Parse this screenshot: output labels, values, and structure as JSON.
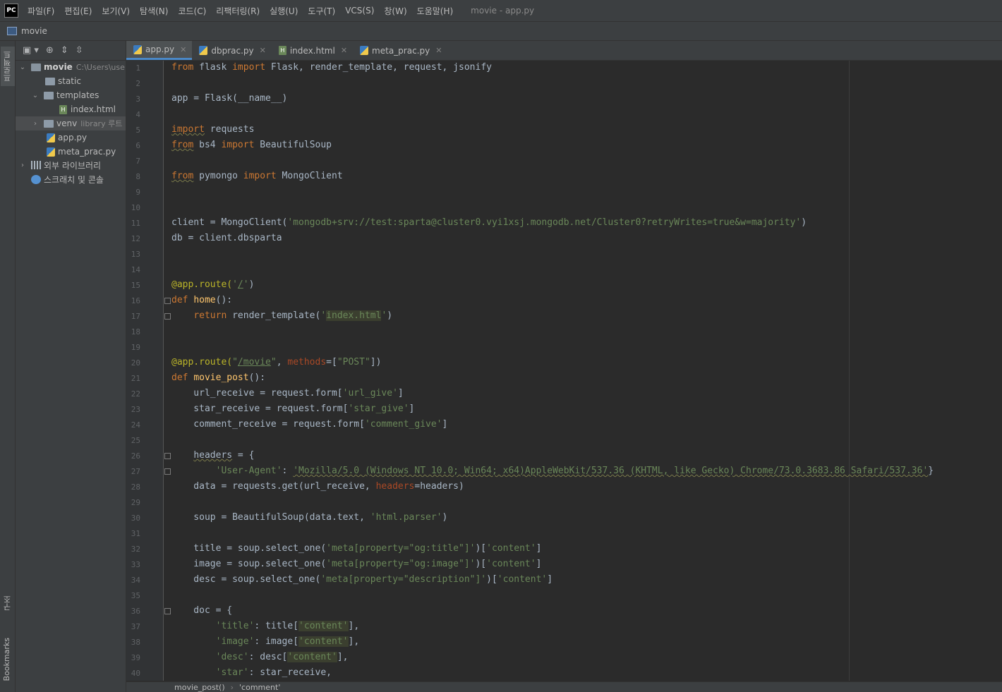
{
  "app": {
    "logo": "PC",
    "window_title": "movie - app.py"
  },
  "menu": [
    "파일(F)",
    "편집(E)",
    "보기(V)",
    "탐색(N)",
    "코드(C)",
    "리팩터링(R)",
    "실행(U)",
    "도구(T)",
    "VCS(S)",
    "창(W)",
    "도움말(H)"
  ],
  "navbar": {
    "project": "movie"
  },
  "tool_stripe": {
    "project": "프로젝트",
    "structure": "구조",
    "bookmarks": "Bookmarks"
  },
  "project_tree": {
    "root_name": "movie",
    "root_path": "C:\\Users\\use",
    "static": "static",
    "templates": "templates",
    "index_html": "index.html",
    "venv": "venv",
    "venv_hint": "library 루트",
    "app_py": "app.py",
    "meta_prac_py": "meta_prac.py",
    "ext_libs": "외부 라이브러리",
    "scratches": "스크래치 및 콘솔"
  },
  "tabs": [
    {
      "label": "app.py",
      "active": true,
      "icon": "python-file-icon"
    },
    {
      "label": "dbprac.py",
      "active": false,
      "icon": "python-file-icon"
    },
    {
      "label": "index.html",
      "active": false,
      "icon": "html-file-icon"
    },
    {
      "label": "meta_prac.py",
      "active": false,
      "icon": "python-file-icon"
    }
  ],
  "line_numbers": [
    "1",
    "2",
    "3",
    "4",
    "5",
    "6",
    "7",
    "8",
    "9",
    "10",
    "11",
    "12",
    "13",
    "14",
    "15",
    "16",
    "17",
    "18",
    "19",
    "20",
    "21",
    "22",
    "23",
    "24",
    "25",
    "26",
    "27",
    "28",
    "29",
    "30",
    "31",
    "32",
    "33",
    "34",
    "35",
    "36",
    "37",
    "38",
    "39",
    "40"
  ],
  "code": {
    "l1_from": "from",
    "l1_a": " flask ",
    "l1_import": "import",
    "l1_b": " Flask, render_template, request, jsonify",
    "l3": "app = Flask(__name__)",
    "l5_import": "import",
    "l5_b": " requests",
    "l6_from": "from",
    "l6_a": " bs4 ",
    "l6_import": "import",
    "l6_b": " BeautifulSoup",
    "l8_from": "from",
    "l8_a": " pymongo ",
    "l8_import": "import",
    "l8_b": " MongoClient",
    "l11_a": "client = MongoClient(",
    "l11_str": "'mongodb+srv://test:sparta@cluster0.vyi1xsj.mongodb.net/Cluster0?retryWrites=true&w=majority'",
    "l11_b": ")",
    "l12": "db = client.dbsparta",
    "l15_dec": "@app.route(",
    "l15_q1": "'",
    "l15_path": "/",
    "l15_q2": "'",
    "l15_end": ")",
    "l16_def": "def",
    "l16_sp": " ",
    "l16_fn": "home",
    "l16_end": "():",
    "l17_ind": "    ",
    "l17_ret": "return",
    "l17_a": " render_template(",
    "l17_q1": "'",
    "l17_hl": "index.html",
    "l17_q2": "'",
    "l17_end": ")",
    "l20_dec": "@app.route(",
    "l20_q1": "\"",
    "l20_path": "/movie",
    "l20_q2": "\"",
    "l20_c": ", ",
    "l20_kw": "methods",
    "l20_eq": "=[",
    "l20_str": "\"POST\"",
    "l20_end": "])",
    "l21_def": "def",
    "l21_sp": " ",
    "l21_fn": "movie_post",
    "l21_end": "():",
    "l22_a": "    url_receive = request.form[",
    "l22_str": "'url_give'",
    "l22_b": "]",
    "l23_a": "    star_receive = request.form[",
    "l23_str": "'star_give'",
    "l23_b": "]",
    "l24_a": "    comment_receive = request.form[",
    "l24_str": "'comment_give'",
    "l24_b": "]",
    "l26_ind": "    ",
    "l26_var": "headers",
    "l26_b": " = {",
    "l27_ind": "        ",
    "l27_key": "'User-Agent'",
    "l27_c": ": ",
    "l27_val": "'Mozilla/5.0 (Windows NT 10.0; Win64; x64)AppleWebKit/537.36 (KHTML, like Gecko) Chrome/73.0.3683.86 Safari/537.36'",
    "l27_end": "}",
    "l28_a": "    data = requests.get(url_receive, ",
    "l28_kw": "headers",
    "l28_b": "=headers)",
    "l30_a": "    soup = BeautifulSoup(data.text, ",
    "l30_str": "'html.parser'",
    "l30_b": ")",
    "l32_a": "    title = soup.select_one(",
    "l32_s1": "'meta[property=\"og:title\"]'",
    "l32_b": ")[",
    "l32_s2": "'content'",
    "l32_c": "]",
    "l33_a": "    image = soup.select_one(",
    "l33_s1": "'meta[property=\"og:image\"]'",
    "l33_b": ")[",
    "l33_s2": "'content'",
    "l33_c": "]",
    "l34_a": "    desc = soup.select_one(",
    "l34_s1": "'meta[property=\"description\"]'",
    "l34_b": ")[",
    "l34_s2": "'content'",
    "l34_c": "]",
    "l36": "    doc = {",
    "l37_ind": "        ",
    "l37_key": "'title'",
    "l37_a": ": title[",
    "l37_hl": "'content'",
    "l37_b": "],",
    "l38_ind": "        ",
    "l38_key": "'image'",
    "l38_a": ": image[",
    "l38_hl": "'content'",
    "l38_b": "],",
    "l39_ind": "        ",
    "l39_key": "'desc'",
    "l39_a": ": desc[",
    "l39_hl": "'content'",
    "l39_b": "],",
    "l40_ind": "        ",
    "l40_key": "'star'",
    "l40_a": ": star_receive,"
  },
  "breadcrumb": [
    "movie_post()",
    "'comment'"
  ],
  "colors": {
    "keyword": "#cc7832",
    "string": "#6a8759",
    "decorator": "#bbb529",
    "function": "#ffc66d",
    "background": "#2b2b2b",
    "panel": "#3c3f41"
  }
}
